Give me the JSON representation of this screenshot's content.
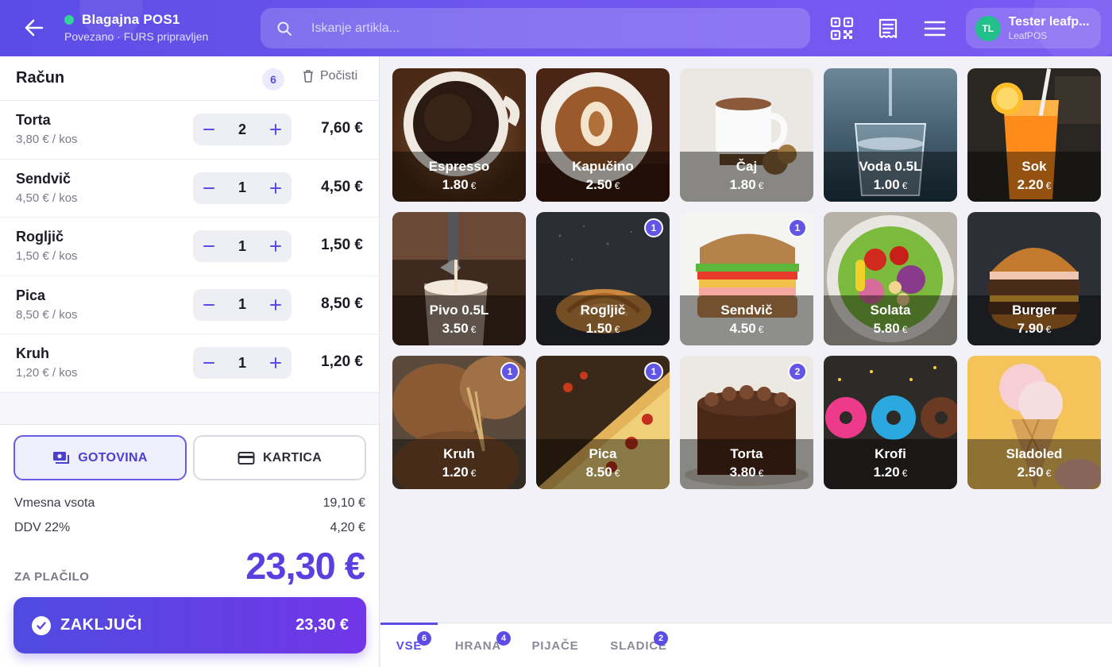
{
  "header": {
    "terminal_name": "Blagajna POS1",
    "terminal_status": "Povezano · FURS pripravljen",
    "search_placeholder": "Iskanje artikla...",
    "user_initials": "TL",
    "user_name": "Tester leafp...",
    "user_org": "LeafPOS",
    "status_color": "#33d39a",
    "icons": [
      "arrow-left-icon",
      "search-icon",
      "qr-code-icon",
      "receipt-icon",
      "menu-icon"
    ]
  },
  "bill": {
    "title": "Račun",
    "count": "6",
    "clear_label": "Počisti",
    "items": [
      {
        "name": "Torta",
        "unit": "3,80 € / kos",
        "qty": "2",
        "total": "7,60 €"
      },
      {
        "name": "Sendvič",
        "unit": "4,50 € / kos",
        "qty": "1",
        "total": "4,50 €"
      },
      {
        "name": "Rogljič",
        "unit": "1,50 € / kos",
        "qty": "1",
        "total": "1,50 €"
      },
      {
        "name": "Pica",
        "unit": "8,50 € / kos",
        "qty": "1",
        "total": "8,50 €"
      },
      {
        "name": "Kruh",
        "unit": "1,20 € / kos",
        "qty": "1",
        "total": "1,20 €"
      }
    ]
  },
  "payment": {
    "cash_label": "GOTOVINA",
    "card_label": "KARTICA",
    "selected": "cash"
  },
  "summary": {
    "subtotal_label": "Vmesna vsota",
    "subtotal_value": "19,10 €",
    "vat_label": "DDV 22%",
    "vat_value": "4,20 €",
    "topay_label": "ZA PLAČILO",
    "topay_value": "23,30 €"
  },
  "finish": {
    "label": "ZAKLJUČI",
    "amount": "23,30 €"
  },
  "products": [
    {
      "name": "Espresso",
      "price": "1.80",
      "currency": "€",
      "qty": null,
      "art": "espresso"
    },
    {
      "name": "Kapučino",
      "price": "2.50",
      "currency": "€",
      "qty": null,
      "art": "cappuccino"
    },
    {
      "name": "Čaj",
      "price": "1.80",
      "currency": "€",
      "qty": null,
      "art": "tea"
    },
    {
      "name": "Voda 0.5L",
      "price": "1.00",
      "currency": "€",
      "qty": null,
      "art": "water"
    },
    {
      "name": "Sok",
      "price": "2.20",
      "currency": "€",
      "qty": null,
      "art": "juice"
    },
    {
      "name": "Pivo 0.5L",
      "price": "3.50",
      "currency": "€",
      "qty": null,
      "art": "beer"
    },
    {
      "name": "Rogljič",
      "price": "1.50",
      "currency": "€",
      "qty": "1",
      "art": "croissant"
    },
    {
      "name": "Sendvič",
      "price": "4.50",
      "currency": "€",
      "qty": "1",
      "art": "sandwich"
    },
    {
      "name": "Solata",
      "price": "5.80",
      "currency": "€",
      "qty": null,
      "art": "salad"
    },
    {
      "name": "Burger",
      "price": "7.90",
      "currency": "€",
      "qty": null,
      "art": "burger"
    },
    {
      "name": "Kruh",
      "price": "1.20",
      "currency": "€",
      "qty": "1",
      "art": "bread"
    },
    {
      "name": "Pica",
      "price": "8.50",
      "currency": "€",
      "qty": "1",
      "art": "pizza"
    },
    {
      "name": "Torta",
      "price": "3.80",
      "currency": "€",
      "qty": "2",
      "art": "cake"
    },
    {
      "name": "Krofi",
      "price": "1.20",
      "currency": "€",
      "qty": null,
      "art": "donuts"
    },
    {
      "name": "Sladoled",
      "price": "2.50",
      "currency": "€",
      "qty": null,
      "art": "icecream"
    }
  ],
  "tabs": [
    {
      "label": "VSE",
      "badge": "6",
      "active": true
    },
    {
      "label": "HRANA",
      "badge": "4",
      "active": false
    },
    {
      "label": "PIJAČE",
      "badge": null,
      "active": false
    },
    {
      "label": "SLADICE",
      "badge": "2",
      "active": false
    }
  ],
  "colors": {
    "accent": "#5b4ce6",
    "total_text": "#5b3fe0",
    "badge": "#6356e6",
    "avatar": "#23c08b"
  }
}
